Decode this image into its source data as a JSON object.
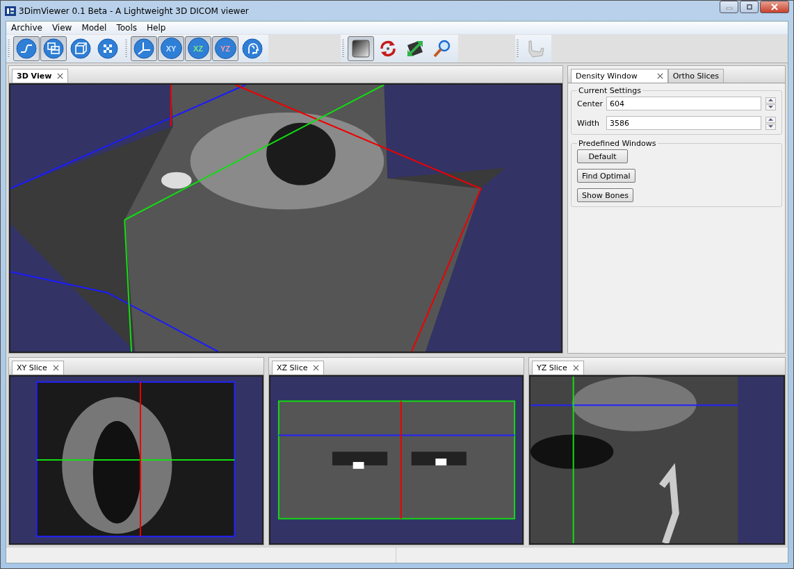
{
  "window": {
    "title": "3DimViewer 0.1 Beta - A Lightweight 3D DICOM viewer"
  },
  "menu": [
    "Archive",
    "View",
    "Model",
    "Tools",
    "Help"
  ],
  "toolbar": {
    "groups": [
      [
        {
          "pressed": true
        },
        {
          "pressed": true
        },
        {
          "pressed": false
        },
        {
          "pressed": false
        }
      ],
      [
        {
          "pressed": true
        },
        {
          "label": "XY",
          "pressed": true
        },
        {
          "label": "XZ",
          "pressed": true
        },
        {
          "label": "YZ",
          "pressed": true
        },
        {
          "pressed": false
        }
      ],
      [
        {
          "pressed": true
        },
        {
          "pressed": false
        },
        {
          "pressed": false
        },
        {
          "pressed": false
        }
      ],
      [
        {
          "pressed": false
        }
      ]
    ]
  },
  "view_3d": {
    "tab": "3D View"
  },
  "side_panel": {
    "tabs": [
      {
        "label": "Density Window",
        "selected": true,
        "closable": true
      },
      {
        "label": "Ortho Slices",
        "selected": false,
        "closable": false
      }
    ],
    "current_settings": {
      "title": "Current Settings",
      "fields": [
        {
          "label": "Center",
          "value": "604"
        },
        {
          "label": "Width",
          "value": "3586"
        }
      ]
    },
    "predefined_windows": {
      "title": "Predefined Windows",
      "buttons": [
        "Default",
        "Find Optimal",
        "Show Bones"
      ]
    }
  },
  "slices": [
    {
      "tab": "XY Slice",
      "kind": "xy"
    },
    {
      "tab": "XZ Slice",
      "kind": "xz"
    },
    {
      "tab": "YZ Slice",
      "kind": "yz"
    }
  ]
}
